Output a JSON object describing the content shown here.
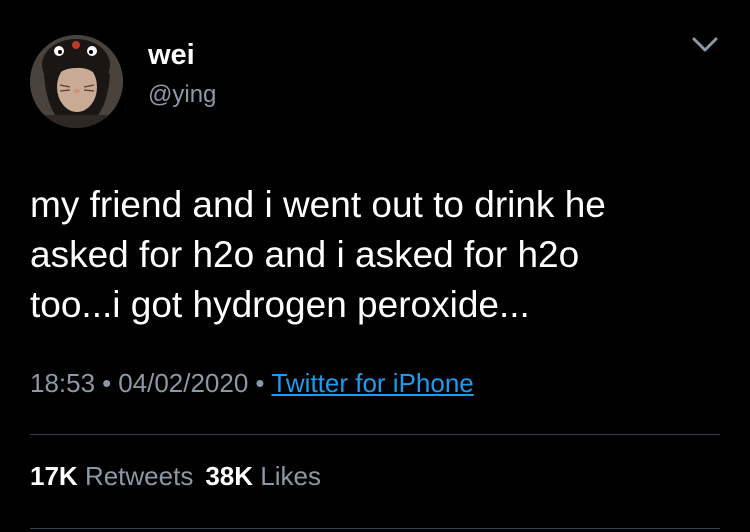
{
  "user": {
    "display_name": "wei",
    "handle": "@ying"
  },
  "tweet": {
    "text": "my friend and i went out to drink he\nasked for h2o and i asked for h2o\ntoo...i got hydrogen peroxide..."
  },
  "meta": {
    "time": "18:53",
    "separator": "•",
    "date": "04/02/2020",
    "source": "Twitter for iPhone"
  },
  "stats": {
    "retweets_count": "17K",
    "retweets_label": "Retweets",
    "likes_count": "38K",
    "likes_label": "Likes"
  },
  "icons": {
    "menu": "chevron-down-icon"
  },
  "colors": {
    "background": "#000000",
    "text": "#ffffff",
    "secondary_text": "#8b98a5",
    "link": "#1d9bf0",
    "divider": "#38444d"
  }
}
